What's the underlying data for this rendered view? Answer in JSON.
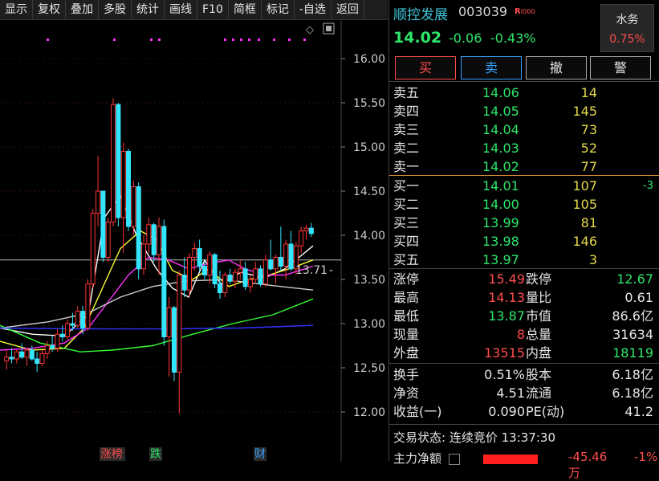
{
  "toolbar": {
    "items": [
      "显示",
      "复权",
      "叠加",
      "多股",
      "统计",
      "画线",
      "F10",
      "简框",
      "标记",
      "-自选",
      "返回"
    ]
  },
  "stock": {
    "name": "顺控发展",
    "code": "003039",
    "badge": "R",
    "price": "14.02",
    "change": "-0.06",
    "change_pct": "-0.43%"
  },
  "sector": {
    "name": "水务",
    "pct": "0.75%"
  },
  "trade_buttons": [
    {
      "label": "买",
      "color": "#ff4d4d"
    },
    {
      "label": "卖",
      "color": "#3aa0ff"
    },
    {
      "label": "撤",
      "color": "#e6e6e6"
    },
    {
      "label": "警",
      "color": "#e6e6e6"
    }
  ],
  "asks": [
    {
      "label": "卖五",
      "price": "14.06",
      "vol": "14"
    },
    {
      "label": "卖四",
      "price": "14.05",
      "vol": "145"
    },
    {
      "label": "卖三",
      "price": "14.04",
      "vol": "73"
    },
    {
      "label": "卖二",
      "price": "14.03",
      "vol": "52"
    },
    {
      "label": "卖一",
      "price": "14.02",
      "vol": "77"
    }
  ],
  "bids": [
    {
      "label": "买一",
      "price": "14.01",
      "vol": "107",
      "delta": "-3"
    },
    {
      "label": "买二",
      "price": "14.00",
      "vol": "105",
      "delta": ""
    },
    {
      "label": "买三",
      "price": "13.99",
      "vol": "81",
      "delta": ""
    },
    {
      "label": "买四",
      "price": "13.98",
      "vol": "146",
      "delta": ""
    },
    {
      "label": "买五",
      "price": "13.97",
      "vol": "3",
      "delta": ""
    }
  ],
  "stats_a": [
    {
      "k1": "涨停",
      "v1": "15.49",
      "c1": "#ff4d4d",
      "k2": "跌停",
      "v2": "12.67",
      "c2": "#2ee66b"
    },
    {
      "k1": "最高",
      "v1": "14.13",
      "c1": "#ff4d4d",
      "k2": "量比",
      "v2": "0.61",
      "c2": "#e6e6e6"
    },
    {
      "k1": "最低",
      "v1": "13.87",
      "c1": "#2ee66b",
      "k2": "市值",
      "v2": "86.6亿",
      "c2": "#e6e6e6"
    },
    {
      "k1": "现量",
      "v1": "8",
      "c1": "#ff4d4d",
      "k2": "总量",
      "v2": "31634",
      "c2": "#e6e6e6"
    },
    {
      "k1": "外盘",
      "v1": "13515",
      "c1": "#ff4d4d",
      "k2": "内盘",
      "v2": "18119",
      "c2": "#2ee66b"
    }
  ],
  "stats_b": [
    {
      "k1": "换手",
      "v1": "0.51%",
      "k2": "股本",
      "v2": "6.18亿"
    },
    {
      "k1": "净资",
      "v1": "4.51",
      "k2": "流通",
      "v2": "6.18亿"
    },
    {
      "k1": "收益(一)",
      "v1": "0.090",
      "k2": "PE(动)",
      "v2": "41.2"
    }
  ],
  "status": {
    "label": "交易状态:",
    "state": "连续竞价",
    "time": "13:37:30"
  },
  "flow": {
    "label": "主力净额",
    "value": "-45.46万",
    "pct": "-1%"
  },
  "chart_data": {
    "type": "candlestick",
    "y_ticks": [
      "16.00",
      "15.50",
      "15.00",
      "14.50",
      "14.00",
      "13.50",
      "13.00",
      "12.50",
      "12.00"
    ],
    "ylim": [
      11.95,
      16.05
    ],
    "price_tag": "13.71",
    "event_tags": [
      {
        "label": "涨榜",
        "color": "#ff4d4d"
      },
      {
        "label": "跌",
        "color": "#2ee66b"
      },
      {
        "label": "财",
        "color": "#3aa0ff"
      }
    ],
    "candles": [
      [
        12.58,
        12.7,
        12.48,
        12.62
      ],
      [
        12.62,
        12.72,
        12.55,
        12.6
      ],
      [
        12.6,
        12.7,
        12.55,
        12.68
      ],
      [
        12.68,
        12.78,
        12.6,
        12.62
      ],
      [
        12.62,
        12.72,
        12.52,
        12.7
      ],
      [
        12.7,
        12.75,
        12.58,
        12.6
      ],
      [
        12.6,
        12.68,
        12.45,
        12.55
      ],
      [
        12.55,
        12.7,
        12.52,
        12.66
      ],
      [
        12.66,
        12.8,
        12.6,
        12.75
      ],
      [
        12.75,
        12.86,
        12.68,
        12.72
      ],
      [
        12.72,
        12.94,
        12.68,
        12.88
      ],
      [
        12.88,
        12.98,
        12.8,
        12.85
      ],
      [
        12.85,
        13.05,
        12.82,
        13.0
      ],
      [
        13.0,
        13.12,
        12.92,
        12.98
      ],
      [
        12.98,
        13.2,
        12.95,
        13.14
      ],
      [
        13.14,
        13.2,
        12.88,
        12.95
      ],
      [
        12.95,
        13.5,
        12.92,
        13.45
      ],
      [
        13.45,
        14.3,
        13.4,
        14.25
      ],
      [
        14.25,
        14.9,
        14.1,
        14.5
      ],
      [
        14.5,
        14.42,
        13.7,
        13.75
      ],
      [
        13.75,
        14.2,
        13.7,
        14.15
      ],
      [
        14.15,
        15.55,
        14.1,
        15.48
      ],
      [
        15.48,
        15.5,
        14.1,
        14.2
      ],
      [
        14.2,
        15.05,
        13.8,
        14.95
      ],
      [
        14.95,
        14.98,
        14.05,
        14.1
      ],
      [
        14.1,
        14.62,
        14.0,
        14.55
      ],
      [
        14.55,
        14.6,
        13.5,
        13.62
      ],
      [
        13.62,
        14.0,
        13.55,
        13.9
      ],
      [
        13.9,
        14.2,
        13.8,
        14.12
      ],
      [
        14.12,
        14.14,
        13.7,
        13.78
      ],
      [
        13.78,
        14.2,
        13.55,
        14.1
      ],
      [
        14.1,
        14.18,
        12.75,
        12.85
      ],
      [
        12.85,
        13.3,
        12.4,
        13.18
      ],
      [
        13.18,
        13.2,
        12.35,
        12.45
      ],
      [
        12.45,
        13.6,
        11.98,
        13.55
      ],
      [
        13.55,
        13.75,
        13.3,
        13.38
      ],
      [
        13.38,
        13.8,
        13.3,
        13.75
      ],
      [
        13.75,
        13.92,
        13.6,
        13.85
      ],
      [
        13.85,
        13.95,
        13.6,
        13.65
      ],
      [
        13.65,
        13.7,
        13.5,
        13.55
      ],
      [
        13.55,
        13.82,
        13.45,
        13.78
      ],
      [
        13.78,
        13.8,
        13.4,
        13.45
      ],
      [
        13.45,
        13.6,
        13.28,
        13.35
      ],
      [
        13.35,
        13.58,
        13.3,
        13.55
      ],
      [
        13.55,
        13.62,
        13.45,
        13.48
      ],
      [
        13.48,
        13.62,
        13.4,
        13.58
      ],
      [
        13.58,
        13.72,
        13.5,
        13.62
      ],
      [
        13.62,
        13.7,
        13.38,
        13.42
      ],
      [
        13.42,
        13.55,
        13.35,
        13.5
      ],
      [
        13.5,
        13.7,
        13.45,
        13.62
      ],
      [
        13.62,
        13.66,
        13.42,
        13.45
      ],
      [
        13.45,
        13.78,
        13.42,
        13.72
      ],
      [
        13.72,
        13.95,
        13.6,
        13.62
      ],
      [
        13.62,
        13.78,
        13.45,
        13.75
      ],
      [
        13.75,
        14.1,
        13.6,
        13.65
      ],
      [
        13.65,
        13.95,
        13.5,
        13.9
      ],
      [
        13.9,
        14.05,
        13.6,
        13.62
      ],
      [
        13.62,
        13.92,
        13.55,
        13.88
      ],
      [
        13.88,
        14.1,
        13.8,
        14.05
      ],
      [
        14.05,
        14.12,
        13.95,
        14.08
      ],
      [
        14.08,
        14.14,
        13.98,
        14.02
      ]
    ],
    "lines": [
      {
        "color": "#ffffff",
        "points": [
          [
            0,
            12.95
          ],
          [
            40,
            12.88
          ],
          [
            80,
            12.86
          ],
          [
            110,
            13.1
          ],
          [
            130,
            14.2
          ],
          [
            150,
            14.45
          ],
          [
            170,
            14.0
          ],
          [
            195,
            13.62
          ],
          [
            215,
            13.4
          ],
          [
            235,
            13.3
          ],
          [
            255,
            13.72
          ],
          [
            275,
            13.45
          ],
          [
            300,
            13.58
          ],
          [
            330,
            13.52
          ],
          [
            355,
            13.62
          ],
          [
            390,
            13.88
          ]
        ]
      },
      {
        "color": "#ffff33",
        "points": [
          [
            0,
            12.8
          ],
          [
            40,
            12.7
          ],
          [
            80,
            12.72
          ],
          [
            105,
            12.95
          ],
          [
            130,
            13.45
          ],
          [
            150,
            13.85
          ],
          [
            175,
            14.05
          ],
          [
            195,
            13.95
          ],
          [
            215,
            13.6
          ],
          [
            240,
            13.5
          ],
          [
            260,
            13.62
          ],
          [
            285,
            13.42
          ],
          [
            310,
            13.5
          ],
          [
            335,
            13.55
          ],
          [
            360,
            13.62
          ],
          [
            390,
            13.72
          ]
        ]
      },
      {
        "color": "#ff33ff",
        "points": [
          [
            0,
            12.7
          ],
          [
            40,
            12.72
          ],
          [
            80,
            12.78
          ],
          [
            110,
            12.95
          ],
          [
            135,
            13.25
          ],
          [
            160,
            13.55
          ],
          [
            185,
            13.75
          ],
          [
            210,
            13.72
          ],
          [
            235,
            13.62
          ],
          [
            260,
            13.68
          ],
          [
            285,
            13.72
          ],
          [
            305,
            13.62
          ],
          [
            330,
            13.55
          ],
          [
            355,
            13.55
          ],
          [
            390,
            13.65
          ]
        ]
      },
      {
        "color": "#cccccc",
        "points": [
          [
            0,
            12.95
          ],
          [
            60,
            13.02
          ],
          [
            110,
            13.12
          ],
          [
            150,
            13.3
          ],
          [
            190,
            13.42
          ],
          [
            230,
            13.48
          ],
          [
            280,
            13.5
          ],
          [
            330,
            13.44
          ],
          [
            390,
            13.38
          ]
        ]
      },
      {
        "color": "#33ff33",
        "points": [
          [
            0,
            12.98
          ],
          [
            50,
            12.78
          ],
          [
            100,
            12.68
          ],
          [
            140,
            12.7
          ],
          [
            190,
            12.75
          ],
          [
            240,
            12.88
          ],
          [
            290,
            13.0
          ],
          [
            340,
            13.1
          ],
          [
            390,
            13.28
          ]
        ]
      },
      {
        "color": "#3333ff",
        "points": [
          [
            0,
            12.95
          ],
          [
            100,
            12.94
          ],
          [
            200,
            12.94
          ],
          [
            300,
            12.95
          ],
          [
            390,
            12.98
          ]
        ]
      }
    ]
  }
}
